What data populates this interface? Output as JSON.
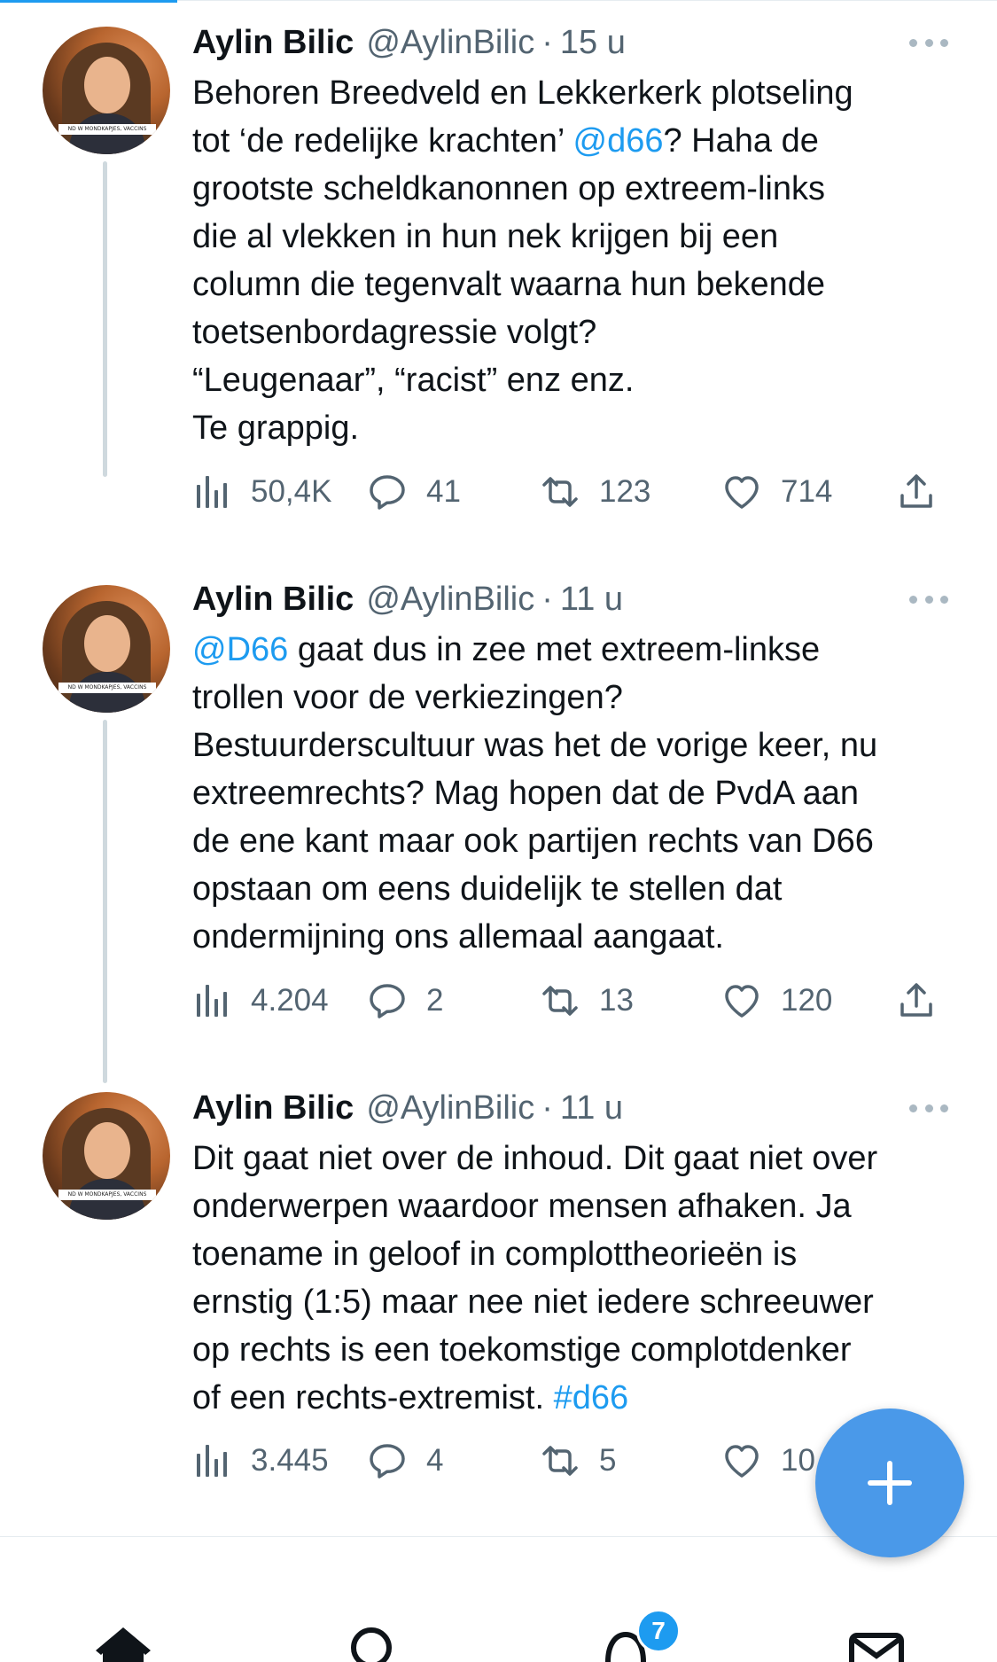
{
  "thread": {
    "tweets": [
      {
        "name": "Aylin Bilic",
        "handle": "@AylinBilic",
        "separator": "·",
        "time": "15 u",
        "lines": [
          "Behoren Breedveld en Lekkerkerk plotseling",
          "tot ‘de redelijke krachten’ ",
          "? Haha de",
          "grootste scheldkanonnen op extreem-links",
          "die al vlekken in hun nek krijgen bij een",
          "column die tegenvalt waarna hun bekende",
          "toetsenbordagressie volgt?",
          "“Leugenaar”, “racist” enz enz.",
          "Te grappig."
        ],
        "mention": "@d66",
        "views": "50,4K",
        "replies": "41",
        "retweets": "123",
        "likes": "714"
      },
      {
        "name": "Aylin Bilic",
        "handle": "@AylinBilic",
        "separator": "·",
        "time": "11 u",
        "mention": "@D66",
        "lines": [
          " gaat dus in zee met extreem-linkse",
          "trollen voor de verkiezingen?",
          "Bestuurderscultuur was het de vorige keer, nu",
          "extreemrechts? Mag hopen dat de PvdA aan",
          "de ene kant maar ook partijen rechts van D66",
          "opstaan om eens duidelijk te stellen dat",
          "ondermijning ons allemaal aangaat."
        ],
        "views": "4.204",
        "replies": "2",
        "retweets": "13",
        "likes": "120"
      },
      {
        "name": "Aylin Bilic",
        "handle": "@AylinBilic",
        "separator": "·",
        "time": "11 u",
        "lines": [
          "Dit gaat niet over de inhoud. Dit gaat niet over",
          "onderwerpen waardoor mensen afhaken. Ja",
          "toename in geloof in complottheorieën is",
          "ernstig (1:5) maar nee niet iedere schreeuwer",
          "op rechts is een toekomstige complotdenker",
          "of een rechts-extremist. "
        ],
        "hashtag": "#d66",
        "views": "3.445",
        "replies": "4",
        "retweets": "5",
        "likes": "10"
      }
    ]
  },
  "avatar_caption": "ND W MONDKAPJES, VACCINS",
  "notifications_badge": "7",
  "icons": {
    "views": "bar-chart-icon",
    "reply": "speech-bubble-icon",
    "retweet": "retweet-icon",
    "like": "heart-icon",
    "share": "share-upload-icon",
    "more": "ellipsis-icon",
    "compose": "plus-icon",
    "nav": [
      "home-icon",
      "search-icon",
      "notifications-bell-icon",
      "messages-mail-icon"
    ]
  },
  "colors": {
    "accent": "#1d9bf0",
    "fab": "#4a99e9",
    "secondary_text": "#536471",
    "thread_line": "#cfd9de"
  }
}
